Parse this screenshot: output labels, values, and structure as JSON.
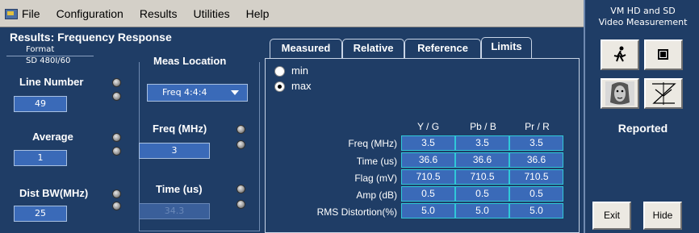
{
  "menu": [
    "File",
    "Configuration",
    "Results",
    "Utilities",
    "Help"
  ],
  "window_title": "Results: Frequency Response",
  "format": {
    "label": "Format",
    "value": "SD 480I/60"
  },
  "line_number": {
    "label": "Line Number",
    "value": "49"
  },
  "average": {
    "label": "Average",
    "value": "1"
  },
  "dist_bw": {
    "label": "Dist BW(MHz)",
    "value": "25"
  },
  "meas_location": {
    "title": "Meas Location",
    "selected": "Freq 4:4:4",
    "freq_label": "Freq (MHz)",
    "freq_value": "3",
    "time_label": "Time (us)",
    "time_value": "34.3"
  },
  "tabs": [
    "Measured",
    "Relative",
    "Reference",
    "Limits"
  ],
  "active_tab": "Limits",
  "radios": [
    {
      "label": "min",
      "checked": false
    },
    {
      "label": "max",
      "checked": true
    }
  ],
  "table": {
    "columns": [
      "Y / G",
      "Pb / B",
      "Pr / R"
    ],
    "rows": [
      {
        "label": "Freq (MHz)",
        "values": [
          "3.5",
          "3.5",
          "3.5"
        ]
      },
      {
        "label": "Time (us)",
        "values": [
          "36.6",
          "36.6",
          "36.6"
        ]
      },
      {
        "label": "Flag (mV)",
        "values": [
          "710.5",
          "710.5",
          "710.5"
        ]
      },
      {
        "label": "Amp  (dB)",
        "values": [
          "0.5",
          "0.5",
          "0.5"
        ]
      },
      {
        "label": "RMS Distortion(%)",
        "values": [
          "5.0",
          "5.0",
          "5.0"
        ]
      }
    ]
  },
  "right_panel": {
    "title_line1": "VM HD and SD",
    "title_line2": "Video Measurement",
    "buttons": [
      "run-icon",
      "stop-icon",
      "face-icon",
      "signal-icon"
    ],
    "reported_label": "Reported",
    "exit_label": "Exit",
    "hide_label": "Hide"
  },
  "colors": {
    "background": "#1f3d66",
    "field": "#3a6ab8",
    "cell_border": "#30c8d8",
    "menubar": "#d4d0c8"
  }
}
